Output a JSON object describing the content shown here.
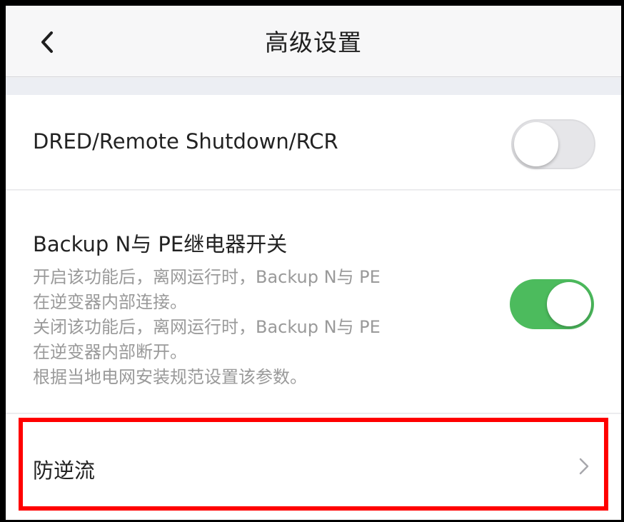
{
  "header": {
    "title": "高级设置",
    "back_icon": "chevron-left-icon"
  },
  "settings": {
    "dred": {
      "label": "DRED/Remote Shutdown/RCR",
      "enabled": false
    },
    "backup_relay": {
      "label": "Backup N与 PE继电器开关",
      "enabled": true,
      "description": [
        "开启该功能后，离网运行时，Backup N与 PE",
        "在逆变器内部连接。",
        "关闭该功能后，离网运行时，Backup N与 PE",
        "在逆变器内部断开。",
        "根据当地电网安装规范设置该参数。"
      ]
    },
    "anti_backflow": {
      "label": "防逆流",
      "icon": "chevron-right-icon"
    }
  },
  "colors": {
    "toggle_on": "#4cbb5d",
    "toggle_off": "#e6e6e9",
    "highlight": "#ff0000"
  }
}
